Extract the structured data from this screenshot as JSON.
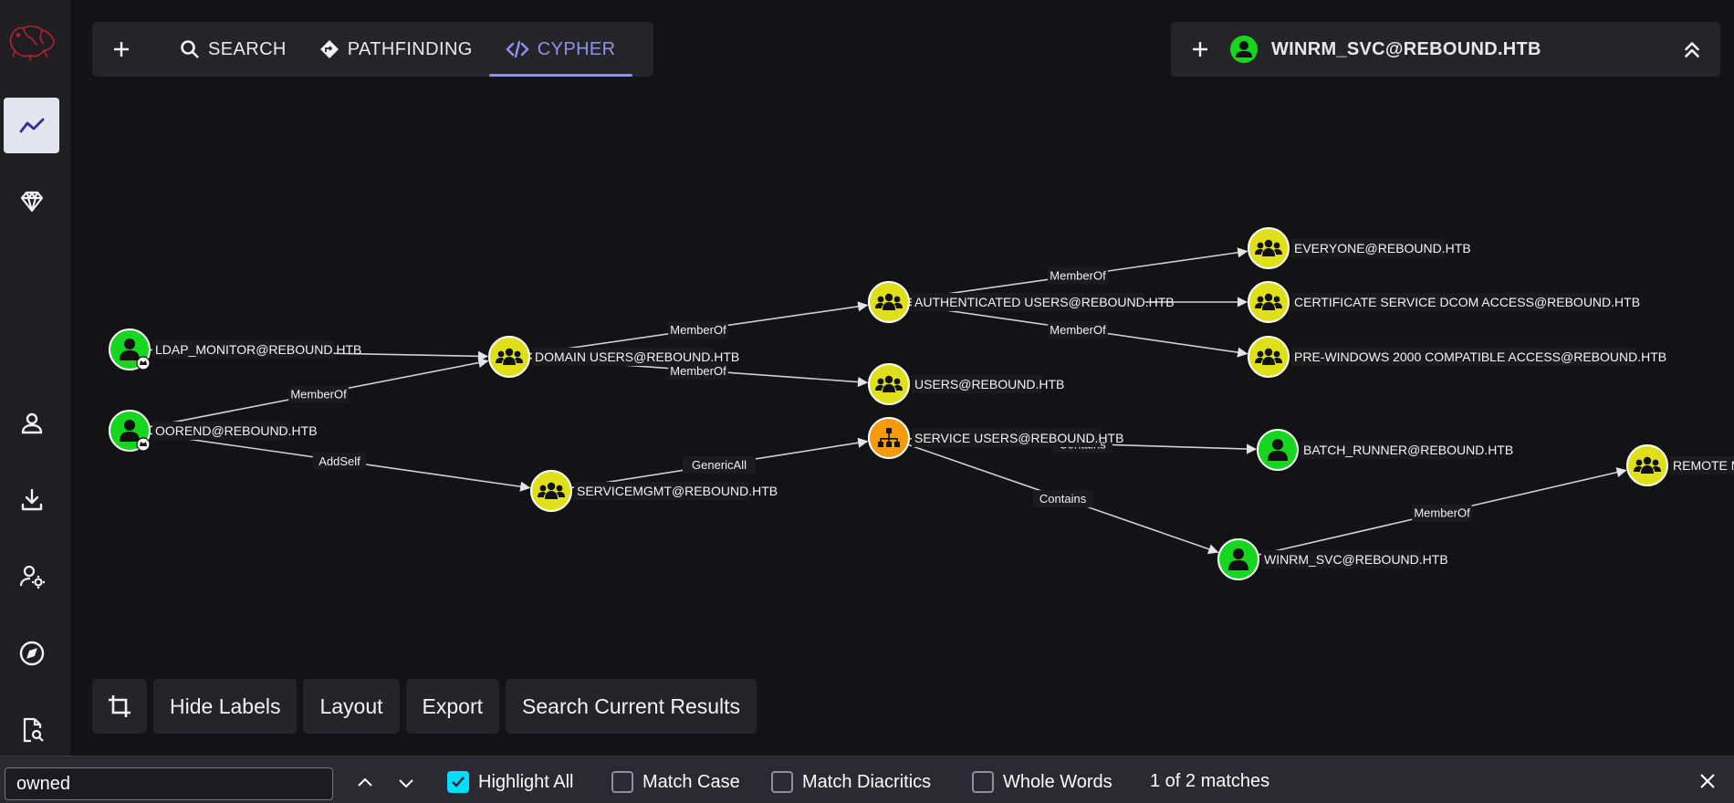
{
  "rail": {
    "items": [
      {
        "name": "bloodhound-logo-icon"
      },
      {
        "name": "explore-graph-icon",
        "active": true
      },
      {
        "name": "attack-paths-diamond-icon"
      },
      {
        "name": "user-icon"
      },
      {
        "name": "download-icon"
      },
      {
        "name": "admin-user-settings-icon"
      },
      {
        "name": "compass-icon"
      },
      {
        "name": "file-search-icon"
      }
    ]
  },
  "tabs": {
    "plus": "+",
    "items": [
      {
        "label": "SEARCH",
        "icon": "search-icon",
        "active": false
      },
      {
        "label": "PATHFINDING",
        "icon": "pathfinding-icon",
        "active": false
      },
      {
        "label": "CYPHER",
        "icon": "code-icon",
        "active": true
      }
    ]
  },
  "entity_panel": {
    "plus": "+",
    "title": "WINRM_SVC@REBOUND.HTB",
    "icon": "user-node-icon",
    "accent": "#17d61f"
  },
  "graph": {
    "colors": {
      "user": "#17d61f",
      "group": "#dfe01a",
      "ou": "#f59a0b",
      "owned_badge": "#ffffff"
    },
    "nodes": [
      {
        "id": "ldap_monitor",
        "label": "LDAP_MONITOR@REBOUND.HTB",
        "type": "user",
        "owned": true
      },
      {
        "id": "oorend",
        "label": "OOREND@REBOUND.HTB",
        "type": "user",
        "owned": true
      },
      {
        "id": "domain_users",
        "label": "DOMAIN USERS@REBOUND.HTB",
        "type": "group"
      },
      {
        "id": "servicemgmt",
        "label": "SERVICEMGMT@REBOUND.HTB",
        "type": "group"
      },
      {
        "id": "authenticated_users",
        "label": "AUTHENTICATED USERS@REBOUND.HTB",
        "type": "group"
      },
      {
        "id": "users",
        "label": "USERS@REBOUND.HTB",
        "type": "group"
      },
      {
        "id": "service_users",
        "label": "SERVICE USERS@REBOUND.HTB",
        "type": "ou"
      },
      {
        "id": "everyone",
        "label": "EVERYONE@REBOUND.HTB",
        "type": "group"
      },
      {
        "id": "cert_dcom",
        "label": "CERTIFICATE SERVICE DCOM ACCESS@REBOUND.HTB",
        "type": "group"
      },
      {
        "id": "pre_win2000",
        "label": "PRE-WINDOWS 2000 COMPATIBLE ACCESS@REBOUND.HTB",
        "type": "group"
      },
      {
        "id": "batch_runner",
        "label": "BATCH_RUNNER@REBOUND.HTB",
        "type": "user"
      },
      {
        "id": "winrm_svc",
        "label": "WINRM_SVC@REBOUND.HTB",
        "type": "user"
      },
      {
        "id": "remote_mgmt",
        "label": "REMOTE M",
        "type": "group"
      }
    ],
    "edges": [
      {
        "from": "ldap_monitor",
        "to": "domain_users",
        "label": ""
      },
      {
        "from": "oorend",
        "to": "domain_users",
        "label": "MemberOf"
      },
      {
        "from": "oorend",
        "to": "servicemgmt",
        "label": "AddSelf"
      },
      {
        "from": "domain_users",
        "to": "authenticated_users",
        "label": "MemberOf"
      },
      {
        "from": "domain_users",
        "to": "users",
        "label": "MemberOf"
      },
      {
        "from": "servicemgmt",
        "to": "service_users",
        "label": "GenericAll"
      },
      {
        "from": "authenticated_users",
        "to": "everyone",
        "label": "MemberOf"
      },
      {
        "from": "authenticated_users",
        "to": "cert_dcom",
        "label": ""
      },
      {
        "from": "authenticated_users",
        "to": "pre_win2000",
        "label": "MemberOf"
      },
      {
        "from": "service_users",
        "to": "batch_runner",
        "label": "Contains"
      },
      {
        "from": "service_users",
        "to": "winrm_svc",
        "label": "Contains"
      },
      {
        "from": "winrm_svc",
        "to": "remote_mgmt",
        "label": "MemberOf"
      }
    ]
  },
  "toolbar": {
    "crop_icon": "crop-icon",
    "hide_labels": "Hide Labels",
    "layout": "Layout",
    "export": "Export",
    "search_results": "Search Current Results"
  },
  "findbar": {
    "value": "owned",
    "highlight_all": "Highlight All",
    "highlight_all_checked": true,
    "match_case": "Match Case",
    "match_diacritics": "Match Diacritics",
    "whole_words": "Whole Words",
    "status": "1 of 2 matches"
  }
}
